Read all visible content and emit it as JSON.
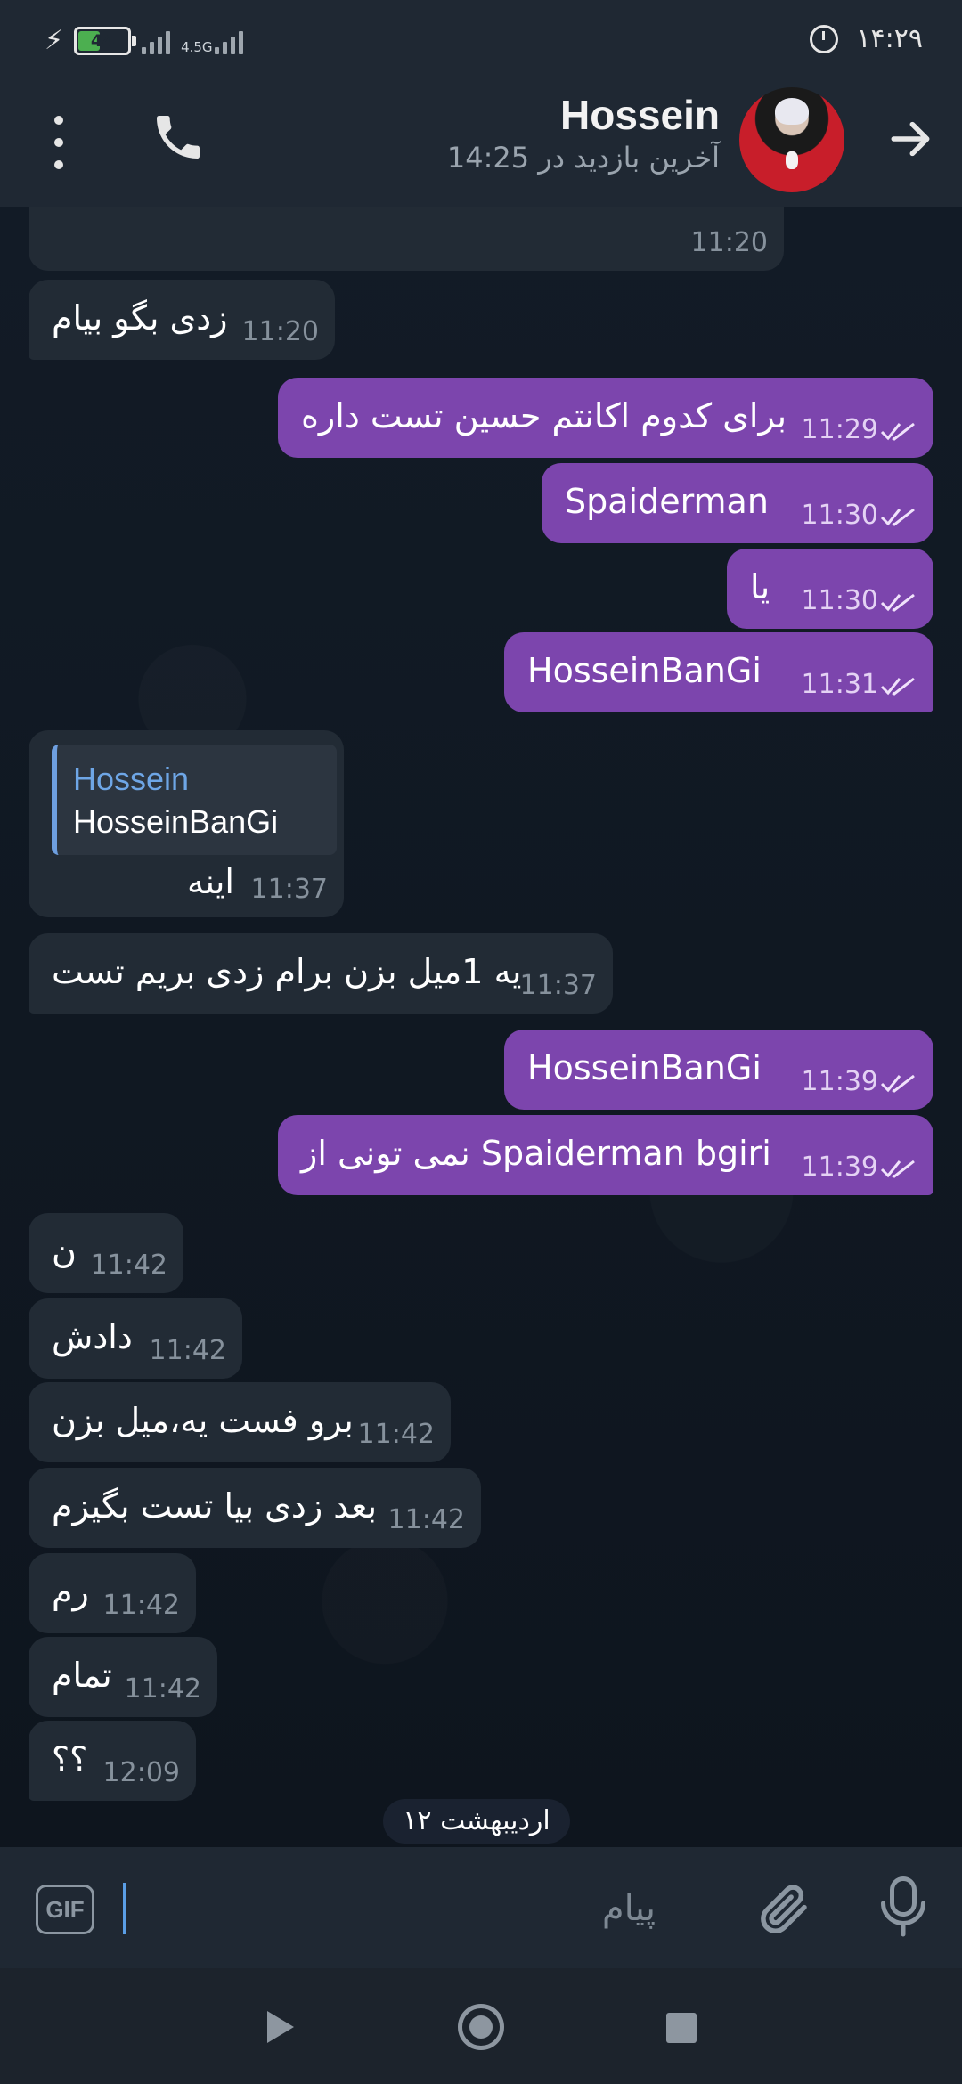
{
  "status_bar": {
    "battery": "44",
    "network": "4.5G",
    "time": "۱۴:۲۹"
  },
  "header": {
    "title": "Hossein",
    "subtitle": "آخرین بازدید در 14:25"
  },
  "date_separator": "۱۲ اردیبهشت",
  "messages": [
    {
      "dir": "in",
      "text": "",
      "time": "11:20"
    },
    {
      "dir": "in",
      "text": "زدی بگو بیام",
      "time": "11:20"
    },
    {
      "dir": "out",
      "text": "برای کدوم اکانتم حسین تست داره",
      "time": "11:29"
    },
    {
      "dir": "out",
      "text": "Spaiderman",
      "time": "11:30"
    },
    {
      "dir": "out",
      "text": "یا",
      "time": "11:30"
    },
    {
      "dir": "out",
      "text": "HosseinBanGi",
      "time": "11:31"
    },
    {
      "dir": "in",
      "text": "اینه",
      "time": "11:37",
      "reply": {
        "name": "Hossein",
        "text": "HosseinBanGi"
      }
    },
    {
      "dir": "in",
      "text": "یه 1میل بزن برام زدی بریم تست",
      "time": "11:37"
    },
    {
      "dir": "out",
      "text": "HosseinBanGi",
      "time": "11:39"
    },
    {
      "dir": "out",
      "text": "نمی تونی از Spaiderman bgiri",
      "time": "11:39"
    },
    {
      "dir": "in",
      "text": "ن",
      "time": "11:42"
    },
    {
      "dir": "in",
      "text": "دادش",
      "time": "11:42"
    },
    {
      "dir": "in",
      "text": "برو فست یه،میل بزن",
      "time": "11:42"
    },
    {
      "dir": "in",
      "text": "بعد زدی بیا تست بگیزم",
      "time": "11:42"
    },
    {
      "dir": "in",
      "text": "رم",
      "time": "11:42"
    },
    {
      "dir": "in",
      "text": "تمام",
      "time": "11:42"
    },
    {
      "dir": "in",
      "text": "؟؟",
      "time": "12:09"
    }
  ],
  "input": {
    "placeholder": "پیام",
    "gif_label": "GIF"
  },
  "icons": {
    "menu": "more-vertical-icon",
    "call": "phone-icon",
    "back": "arrow-right-icon",
    "attach": "paperclip-icon",
    "mic": "microphone-icon"
  },
  "colors": {
    "outgoing_bubble": "#7c45ad",
    "incoming_bubble": "#222b35",
    "header": "#1f2833",
    "reply_accent": "#6ea6e6"
  }
}
